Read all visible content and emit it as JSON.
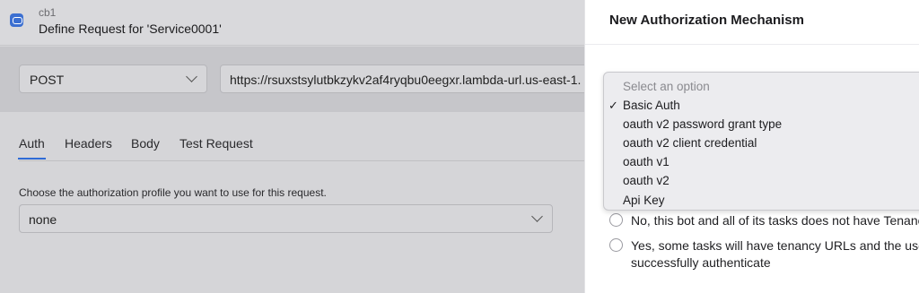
{
  "header": {
    "bot_name": "cb1",
    "title": "Define Request for 'Service0001'"
  },
  "request": {
    "method": "POST",
    "url": "https://rsuxstsylutbkzykv2af4ryqbu0eegxr.lambda-url.us-east-1."
  },
  "tabs": [
    {
      "label": "Auth",
      "active": true
    },
    {
      "label": "Headers",
      "active": false
    },
    {
      "label": "Body",
      "active": false
    },
    {
      "label": "Test Request",
      "active": false
    }
  ],
  "auth": {
    "label": "Choose the authorization profile you want to use for this request.",
    "value": "none"
  },
  "panel": {
    "title": "New Authorization Mechanism",
    "dropdown": {
      "placeholder": "Select an option",
      "selected_index": 0,
      "options": [
        "Basic Auth",
        "oauth v2 password grant type",
        "oauth v2 client credential",
        "oauth v1",
        "oauth v2",
        "Api Key"
      ]
    },
    "tenancy_options": [
      {
        "line1": "No, this bot and all of its tasks does not have Tenanc",
        "line2": ""
      },
      {
        "line1": "Yes, some tasks will have tenancy URLs and the user",
        "line2": "successfully authenticate"
      }
    ]
  },
  "colors": {
    "accent": "#2f6bd6",
    "overlay_bg": "#d5d5d8",
    "panel_bg": "#ffffff"
  }
}
